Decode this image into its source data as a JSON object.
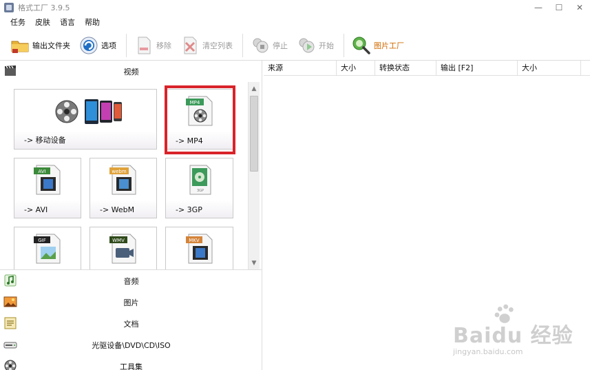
{
  "window": {
    "title": "格式工厂 3.9.5",
    "controls": {
      "minimize": "—",
      "maximize": "☐",
      "close": "✕"
    }
  },
  "menu": [
    "任务",
    "皮肤",
    "语言",
    "帮助"
  ],
  "toolbar": {
    "output_folder": "输出文件夹",
    "options": "选项",
    "remove": "移除",
    "clear_list": "清空列表",
    "stop": "停止",
    "start": "开始",
    "picture_factory": "图片工厂"
  },
  "categories": {
    "video": "视频",
    "audio": "音频",
    "picture": "图片",
    "document": "文档",
    "disc": "光驱设备\\DVD\\CD\\ISO",
    "tools": "工具集"
  },
  "video_tiles": [
    {
      "label": "-> 移动设备"
    },
    {
      "label": "-> MP4",
      "badge": "MP4"
    },
    {
      "label": "-> AVI",
      "badge": "AVI"
    },
    {
      "label": "-> WebM",
      "badge": "webm"
    },
    {
      "label": "-> 3GP",
      "badge": "3GP"
    },
    {
      "label": "",
      "badge": "GIF"
    },
    {
      "label": "",
      "badge": "WMV"
    },
    {
      "label": "",
      "badge": "MKV"
    }
  ],
  "file_list": {
    "columns": [
      "来源",
      "大小",
      "转换状态",
      "输出 [F2]",
      "大小"
    ]
  },
  "watermark": {
    "main": "Baidu 经验",
    "sub": "jingyan.baidu.com"
  },
  "colors": {
    "highlight": "#d9232a",
    "accent": "#1f6fc4"
  }
}
